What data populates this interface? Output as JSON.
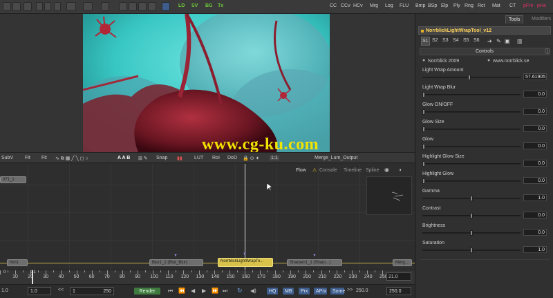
{
  "toolbar": {
    "labels_left": [
      "LD",
      "SV",
      "BG",
      "Tx"
    ],
    "labels_right": [
      "CC",
      "CCv",
      "HCv",
      "Mrg",
      "Log",
      "FLU",
      "Bmp",
      "BSp",
      "Elp",
      "Ply",
      "Rng",
      "Rct",
      "Mat",
      "CT",
      "pFre",
      "pHa"
    ]
  },
  "watermark": "www.cg-ku.com",
  "viewer_bar": {
    "subv": "SubV",
    "fit1": "Fit",
    "fit2": "Fit",
    "snap": "Snap",
    "lut": "LUT",
    "roi": "RoI",
    "dod": "DoD",
    "ratio": "1:1",
    "merge_name": "Merge_Lum_Output"
  },
  "flow_tabs": {
    "flow": "Flow",
    "console": "Console",
    "timeline": "Timeline",
    "spline": "Spline"
  },
  "flow_nodes": {
    "loader": "071_1",
    "node_a": "Nrn1",
    "node_b": "Blur1_1 (Blur_Blur)",
    "node_c": "NorrblickLightWrapTo...",
    "node_d": "Sharpen1_1 (Sharp...)",
    "node_e": "Merg..."
  },
  "timeline": {
    "ticks": [
      "10",
      "20",
      "30",
      "40",
      "50",
      "60",
      "70",
      "80",
      "90",
      "100",
      "110",
      "120",
      "130",
      "140",
      "150",
      "160",
      "170",
      "180",
      "190",
      "200",
      "210",
      "220",
      "230",
      "240",
      "250"
    ],
    "current_frame": "21.0",
    "frame_marker": "0",
    "current_marker": "21"
  },
  "bottombar": {
    "start": "1.0",
    "end_box": "1.0",
    "range_start": "1",
    "range_end": "250",
    "render_label": "Render",
    "hq": "HQ",
    "mb": "MB",
    "prx": "Prx",
    "aprx": "APrx",
    "some": "Some",
    "end_frame": "250.0",
    "total_frame": "250.0"
  },
  "right_panel": {
    "tab_tools": "Tools",
    "tab_modifiers": "Modifiers",
    "tool_title": "NorrblickLightWrapTool_v12",
    "sub_tabs": [
      "S1",
      "S2",
      "S3",
      "S4",
      "S5",
      "S6"
    ],
    "controls_title": "Controls",
    "credit_left": "Norrblick 2009",
    "credit_right": "www.norrblick.se",
    "controls": [
      {
        "label": "Light Wrap Amount",
        "value": "57.61905",
        "frac": 0.48
      },
      {
        "label": "Light Wrap Blur",
        "value": "0.0",
        "frac": 0.0
      },
      {
        "label": "Glow ON/OFF",
        "value": "0.0",
        "frac": 0.0
      },
      {
        "label": "Glow Size",
        "value": "0.0",
        "frac": 0.0
      },
      {
        "label": "Glow",
        "value": "0.0",
        "frac": 0.0
      },
      {
        "label": "Highlight Glow Size",
        "value": "0.0",
        "frac": 0.0
      },
      {
        "label": "Highlight Glow",
        "value": "0.0",
        "frac": 0.0
      },
      {
        "label": "Gamma",
        "value": "1.0",
        "frac": 0.5
      },
      {
        "label": "Contrast",
        "value": "0.0",
        "frac": 0.5
      },
      {
        "label": "Brightness",
        "value": "0.0",
        "frac": 0.5
      },
      {
        "label": "Saturation",
        "value": "1.0",
        "frac": 0.5
      }
    ]
  },
  "colors": {
    "accent_yellow": "#f0e400",
    "tool_title": "#ffd45a",
    "toolbar_green": "#6fcf3a",
    "image_cyan": "#3fd6d2"
  }
}
